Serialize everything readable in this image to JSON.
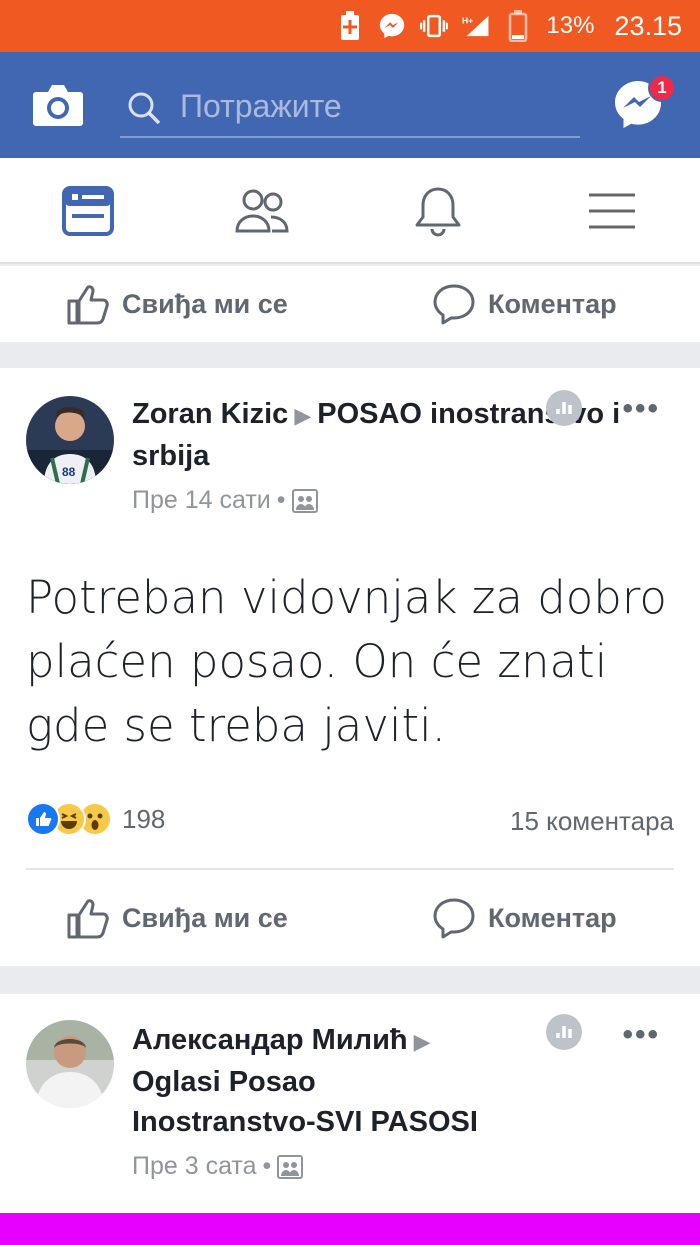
{
  "status_bar": {
    "battery_percent": "13%",
    "time": "23.15",
    "icons": [
      "battery-saver-icon",
      "messenger-notification-icon",
      "vibrate-icon",
      "signal-icon",
      "battery-icon"
    ],
    "color": "#f05a22"
  },
  "app_bar": {
    "search_placeholder": "Потражите",
    "messenger_badge": "1",
    "color": "#4267b2"
  },
  "tabs": [
    "news-feed-icon",
    "friends-icon",
    "notifications-icon",
    "menu-icon"
  ],
  "top_actions": {
    "like": "Свиђа ми се",
    "comment": "Коментар"
  },
  "post1": {
    "author": "Zoran Kizic",
    "group": "POSAO inostranstvo i srbija",
    "time": "Пре 14 сати",
    "text": "Potreban vidovnjak za dobro plaćen posao. On će znati gde se treba javiti.",
    "reaction_count": "198",
    "comments": "15 коментара",
    "like_label": "Свиђа ми се",
    "comment_label": "Коментар"
  },
  "post2": {
    "author": "Александар Милић",
    "group_line1": "Oglasi Posao",
    "group_line2": "Inostranstvo-SVI PASOSI",
    "time": "Пре 3 сата"
  }
}
